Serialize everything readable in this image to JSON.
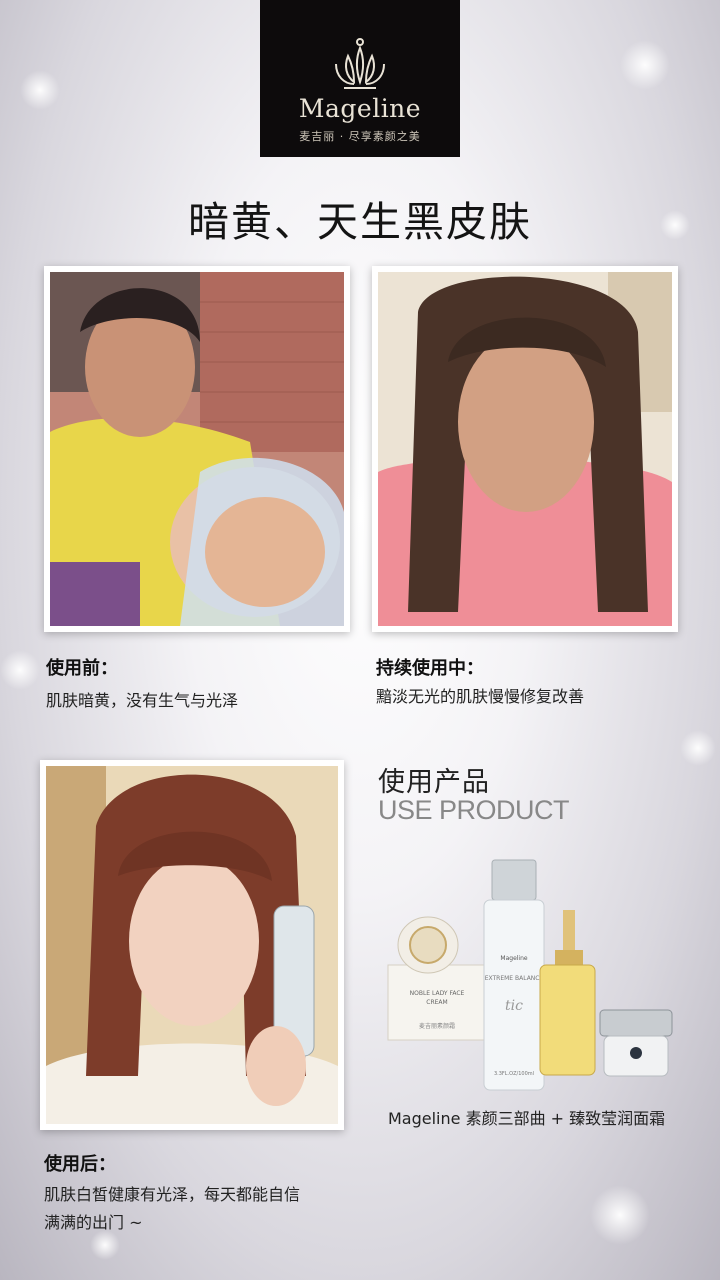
{
  "logo": {
    "name": "Mageline",
    "tagline": "麦吉丽 · 尽享素颜之美"
  },
  "headline": "暗黄、天生黑皮肤",
  "before": {
    "title": "使用前：",
    "text": "肌肤暗黄，没有生气与光泽"
  },
  "during": {
    "title": "持续使用中：",
    "text": "黯淡无光的肌肤慢慢修复改善"
  },
  "after": {
    "title": "使用后：",
    "text_line1": "肌肤白皙健康有光泽，每天都能自信",
    "text_line2": "满满的出门 ~"
  },
  "use_product": {
    "cn": "使用产品",
    "en": "USE PRODUCT"
  },
  "product_caption": "Mageline 素颜三部曲 + 臻致莹润面霜",
  "product_labels": {
    "bottle_brand": "Mageline",
    "bottle_line": "EXTREME BALANCE",
    "bottle_script": "tic",
    "bottle_volume": "3.3FL.OZ/100ml",
    "cream_line1": "NOBLE LADY FACE",
    "cream_line2": "CREAM",
    "cream_box": "麦吉丽素颜霜"
  }
}
